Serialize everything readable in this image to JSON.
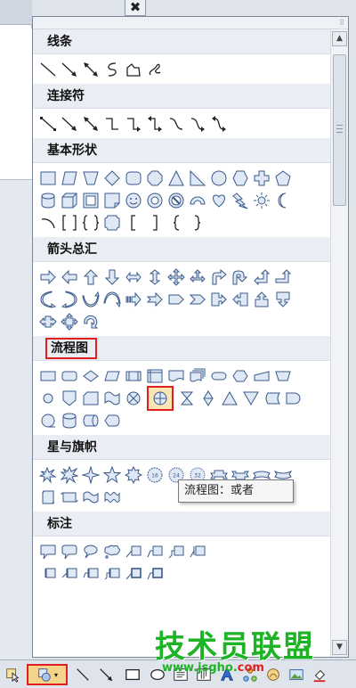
{
  "window": {
    "close_glyph": "✖",
    "resize_glyph": "⠿"
  },
  "sections": [
    {
      "title": "线条",
      "highlighted": false
    },
    {
      "title": "连接符",
      "highlighted": false
    },
    {
      "title": "基本形状",
      "highlighted": false
    },
    {
      "title": "箭头总汇",
      "highlighted": false
    },
    {
      "title": "流程图",
      "highlighted": true
    },
    {
      "title": "星与旗帜",
      "highlighted": false
    },
    {
      "title": "标注",
      "highlighted": false
    }
  ],
  "tooltip": {
    "text": "流程图：或者"
  },
  "scrollbar": {
    "up_glyph": "▲",
    "down_glyph": "▼"
  },
  "toolbar": {
    "shapes_arrow": "▾"
  },
  "watermark": {
    "brand": "技术员联盟",
    "url_prefix": "www.jsgho.",
    "url_suffix": "com"
  },
  "colors": {
    "highlight": "#e0201f",
    "selected_fill": "#fde6b6",
    "shape_stroke": "#3b5a8a",
    "shape_fill": "#dfe8f5",
    "watermark": "#1cb324"
  }
}
